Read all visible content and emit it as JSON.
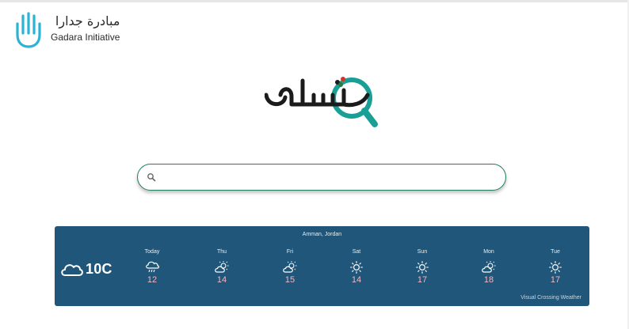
{
  "header": {
    "logo_ar": "مبادرة جدارا",
    "logo_en": "Gadara Initiative"
  },
  "brand": {
    "wordmark": "نشامى",
    "colors": {
      "teal": "#1a9f96",
      "dark": "#1b1b1b",
      "red": "#d6342b",
      "green": "#1f7f3c"
    }
  },
  "search": {
    "value": "",
    "placeholder": "",
    "border_color": "#1f7f5c"
  },
  "weather": {
    "location": "Amman, Jordan",
    "current": {
      "icon": "cloud-icon",
      "temp": "10C"
    },
    "days": [
      {
        "name": "Today",
        "icon": "rain-cloud-icon",
        "temp": "12"
      },
      {
        "name": "Thu",
        "icon": "partly-sunny-icon",
        "temp": "14"
      },
      {
        "name": "Fri",
        "icon": "partly-sunny-icon",
        "temp": "15"
      },
      {
        "name": "Sat",
        "icon": "sun-icon",
        "temp": "14"
      },
      {
        "name": "Sun",
        "icon": "sun-icon",
        "temp": "17"
      },
      {
        "name": "Mon",
        "icon": "partly-sunny-icon",
        "temp": "18"
      },
      {
        "name": "Tue",
        "icon": "sun-icon",
        "temp": "17"
      }
    ],
    "credit": "Visual Crossing Weather",
    "colors": {
      "background": "#1f5679",
      "temp_text": "#f3b6c3"
    }
  }
}
